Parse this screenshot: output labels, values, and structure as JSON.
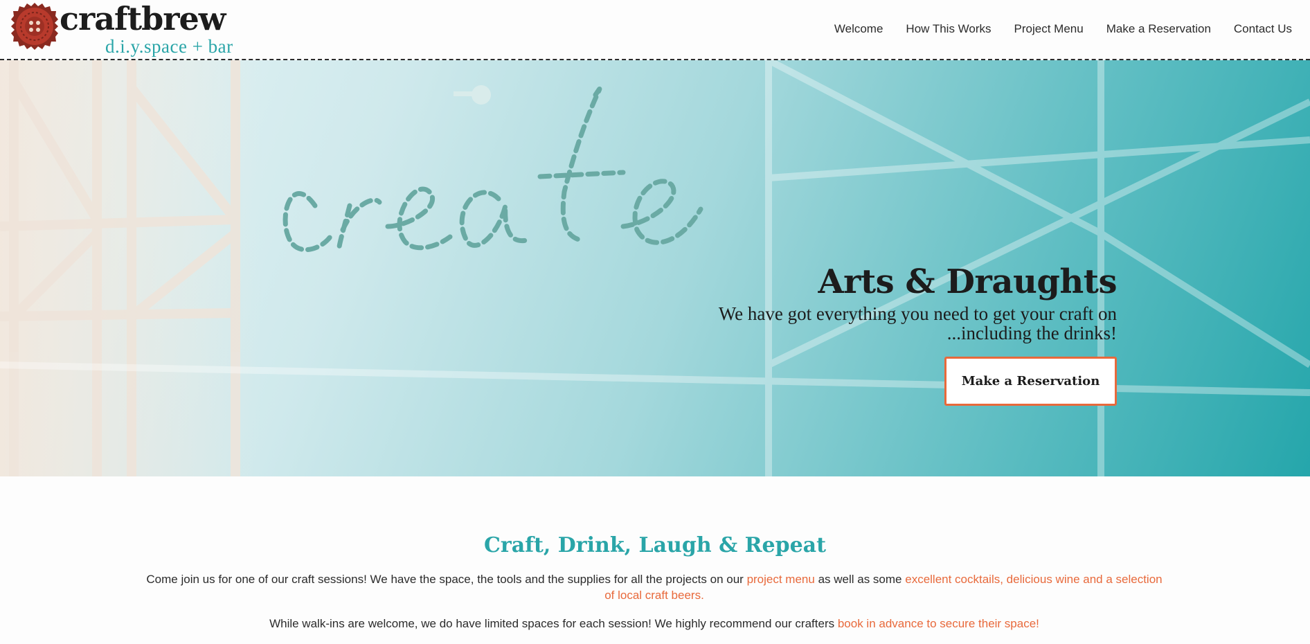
{
  "brand": {
    "name": "craftbrew",
    "tagline": "d.i.y.space + bar",
    "badge_icon": "bottle-cap-button-icon",
    "colors": {
      "accent": "#2aa5a8",
      "cta": "#e8693b",
      "badge": "#b83a2c"
    }
  },
  "nav": {
    "items": [
      {
        "label": "Welcome"
      },
      {
        "label": "How This Works"
      },
      {
        "label": "Project Menu"
      },
      {
        "label": "Make a Reservation"
      },
      {
        "label": "Contact Us"
      }
    ]
  },
  "hero": {
    "title": "Arts & Draughts",
    "subtitle_line1": "We have got everything you need to get your craft on",
    "subtitle_line2": "...including the drinks!",
    "cta_label": "Make a Reservation"
  },
  "intro": {
    "heading": "Craft, Drink, Laugh & Repeat",
    "p1_before": "Come join us for one of our craft sessions! We have the space, the tools and the supplies for all the projects on our ",
    "p1_link1": "project menu",
    "p1_middle": " as well as some ",
    "p1_link2": "excellent cocktails, delicious wine and a selection of local craft beers.",
    "p2_before": "While walk-ins are welcome, we do have limited spaces for each session! We highly recommend our crafters ",
    "p2_link": "book in advance to secure their space!"
  }
}
